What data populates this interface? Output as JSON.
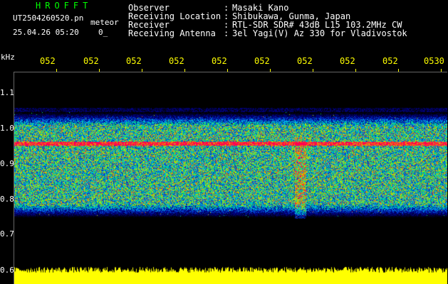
{
  "header": {
    "app_title": "HROFFT",
    "file_name": "UT2504260520.pn",
    "mode": "meteor",
    "date_time": "25.04.26 05:20",
    "counter": "0_"
  },
  "info": [
    {
      "label": "Observer",
      "sep": ":",
      "value": "Masaki Kano"
    },
    {
      "label": "Receiving Location",
      "sep": ":",
      "value": "Shibukawa, Gunma, Japan"
    },
    {
      "label": "Receiver",
      "sep": ":",
      "value": "RTL-SDR SDR# 43dB L15 103.2MHz CW"
    },
    {
      "label": "Receiving Antenna",
      "sep": ":",
      "value": "3el Yagi(V) Az 330 for Vladivostok"
    }
  ],
  "axis": {
    "unit": "kHz",
    "y_ticks": [
      "1.1",
      "1.0",
      "0.9",
      "0.8",
      "0.7",
      "0.6"
    ],
    "x_ticks": [
      "052",
      "052",
      "052",
      "052",
      "052",
      "052",
      "052",
      "052",
      "052",
      "0530"
    ]
  },
  "colors": {
    "background": "#000000",
    "title": "#00ff00",
    "time_axis": "#ffff00",
    "text": "#ffffff",
    "noise_floor": "#ffff00"
  },
  "spectrogram": {
    "band_top_khz": 1.05,
    "band_bottom_khz": 0.75,
    "carrier_khz": 0.96,
    "burst_time_fraction": 0.66
  }
}
